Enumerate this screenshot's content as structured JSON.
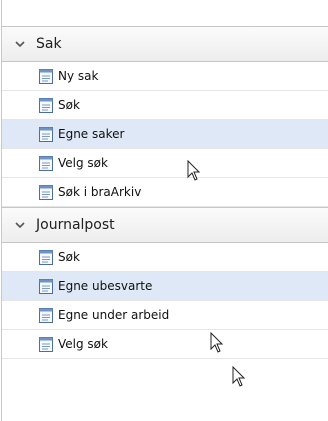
{
  "sections": [
    {
      "title": "Sak",
      "icon": "chevron-down-icon",
      "items": [
        {
          "label": "Ny sak",
          "icon": "document-icon",
          "selected": false
        },
        {
          "label": "Søk",
          "icon": "document-icon",
          "selected": false
        },
        {
          "label": "Egne saker",
          "icon": "document-icon",
          "selected": true
        },
        {
          "label": "Velg søk",
          "icon": "document-icon",
          "selected": false
        },
        {
          "label": "Søk i braArkiv",
          "icon": "document-icon",
          "selected": false
        }
      ]
    },
    {
      "title": "Journalpost",
      "icon": "chevron-down-icon",
      "items": [
        {
          "label": "Søk",
          "icon": "document-icon",
          "selected": false
        },
        {
          "label": "Egne ubesvarte",
          "icon": "document-icon",
          "selected": true
        },
        {
          "label": "Egne under arbeid",
          "icon": "document-icon",
          "selected": false
        },
        {
          "label": "Velg søk",
          "icon": "document-icon",
          "selected": false
        }
      ]
    }
  ],
  "colors": {
    "selected_background": "#dfe8f6",
    "header_background": "#f2f2f2",
    "text": "#111111"
  }
}
